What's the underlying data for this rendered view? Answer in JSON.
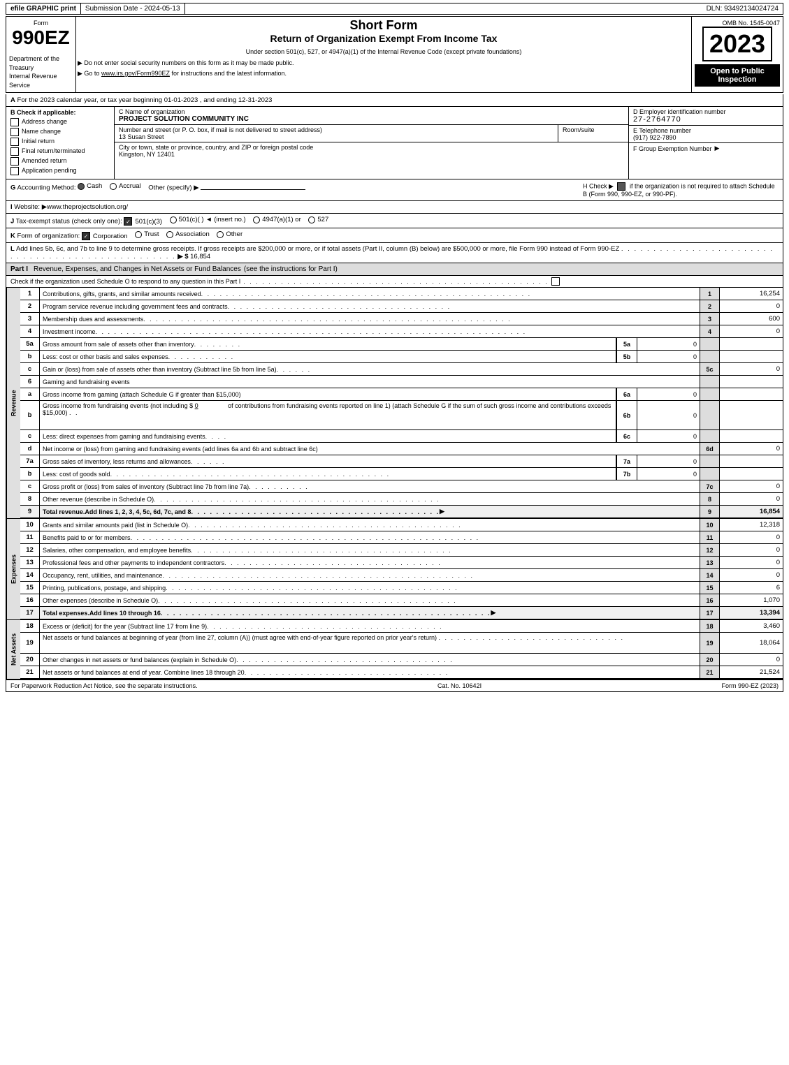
{
  "topBar": {
    "graphic": "efile GRAPHIC print",
    "submission": "Submission Date - 2024-05-13",
    "dln": "DLN: 93492134024724"
  },
  "header": {
    "ombNo": "OMB No. 1545-0047",
    "formNumber": "990EZ",
    "shortForm": "Short Form",
    "returnTitle": "Return of Organization Exempt From Income Tax",
    "underSection": "Under section 501(c), 527, or 4947(a)(1) of the Internal Revenue Code (except private foundations)",
    "socialSecNote": "▶ Do not enter social security numbers on this form as it may be made public.",
    "gotoNote": "▶ Go to www.irs.gov/Form990EZ for instructions and the latest information.",
    "year": "2023",
    "openToPublic": "Open to Public Inspection",
    "deptLine1": "Department of the",
    "deptLine2": "Treasury",
    "deptLine3": "Internal Revenue",
    "deptLine4": "Service"
  },
  "sectionA": {
    "label": "A",
    "text": "For the 2023 calendar year, or tax year beginning 01-01-2023 , and ending 12-31-2023"
  },
  "sectionB": {
    "label": "B Check if applicable:",
    "addressChange": "Address change",
    "nameChange": "Name change",
    "initialReturn": "Initial return",
    "finalReturn": "Final return/terminated",
    "amendedReturn": "Amended return",
    "applicationPending": "Application pending"
  },
  "orgInfo": {
    "cLabel": "C Name of organization",
    "orgName": "PROJECT SOLUTION COMMUNITY INC",
    "streetLabel": "Number and street (or P. O. box, if mail is not delivered to street address)",
    "streetValue": "13 Susan Street",
    "roomLabel": "Room/suite",
    "roomValue": "",
    "cityLabel": "City or town, state or province, country, and ZIP or foreign postal code",
    "cityValue": "Kingston, NY  12401",
    "dLabel": "D Employer identification number",
    "ein": "27-2764770",
    "eLabel": "E Telephone number",
    "phone": "(917) 922-7890",
    "fLabel": "F Group Exemption Number",
    "fValue": ""
  },
  "sectionG": {
    "label": "G",
    "text": "Accounting Method:",
    "cash": "Cash",
    "cashChecked": true,
    "accrual": "Accrual",
    "accrualChecked": false,
    "other": "Other (specify) ▶",
    "otherValue": "",
    "hLabel": "H Check ▶",
    "hText": "if the organization is not required to attach Schedule B (Form 990, 990-EZ, or 990-PF).",
    "hChecked": true
  },
  "sectionI": {
    "label": "I",
    "text": "Website: ▶www.theprojectsolution.org/"
  },
  "sectionJ": {
    "label": "J",
    "text": "Tax-exempt status (check only one):",
    "options": [
      "501(c)(3)",
      "501(c)(  ) ◄ (insert no.)",
      "4947(a)(1) or",
      "527"
    ],
    "selected": "501(c)(3)"
  },
  "sectionK": {
    "label": "K",
    "text": "Form of organization:",
    "options": [
      "Corporation",
      "Trust",
      "Association",
      "Other"
    ],
    "selected": "Corporation"
  },
  "sectionL": {
    "text": "L Add lines 5b, 6c, and 7b to line 9 to determine gross receipts. If gross receipts are $200,000 or more, or if total assets (Part II, column (B) below) are $500,000 or more, file Form 990 instead of Form 990-EZ",
    "dots": ". . . . . . . . . . . . . . . . . . . . . . . . . . . . . . . . . . . . . . . . . . . . . . . . . .",
    "arrow": "▶ $",
    "value": "16,854"
  },
  "partI": {
    "title": "Part I",
    "description": "Revenue, Expenses, and Changes in Net Assets or Fund Balances",
    "seeInstructions": "(see the instructions for Part I)",
    "checkNote": "Check if the organization used Schedule O to respond to any question in this Part I",
    "rows": [
      {
        "num": "1",
        "desc": "Contributions, gifts, grants, and similar amounts received",
        "dots": true,
        "lineNum": "1",
        "value": "16,254"
      },
      {
        "num": "2",
        "desc": "Program service revenue including government fees and contracts",
        "dots": true,
        "lineNum": "2",
        "value": "0"
      },
      {
        "num": "3",
        "desc": "Membership dues and assessments",
        "dots": true,
        "lineNum": "3",
        "value": "600"
      },
      {
        "num": "4",
        "desc": "Investment income",
        "dots": true,
        "lineNum": "4",
        "value": "0"
      },
      {
        "num": "5a",
        "subLabel": "a",
        "desc": "Gross amount from sale of assets other than inventory",
        "dots": true,
        "inlineLabel": "5a",
        "inlineValue": "0"
      },
      {
        "num": "5b",
        "subLabel": "b",
        "desc": "Less: cost or other basis and sales expenses",
        "dots": true,
        "inlineLabel": "5b",
        "inlineValue": "0"
      },
      {
        "num": "5c",
        "subLabel": "c",
        "desc": "Gain or (loss) from sale of assets other than inventory (Subtract line 5b from line 5a)",
        "dots": true,
        "lineNum": "5c",
        "value": "0"
      },
      {
        "num": "6",
        "desc": "Gaming and fundraising events"
      },
      {
        "num": "6a",
        "subLabel": "a",
        "desc": "Gross income from gaming (attach Schedule G if greater than $15,000)",
        "inlineLabel": "6a",
        "inlineValue": "0"
      },
      {
        "num": "6b",
        "subLabel": "b",
        "desc": "Gross income from fundraising events (not including $ 0 of contributions from fundraising events reported on line 1) (attach Schedule G if the sum of such gross income and contributions exceeds $15,000)",
        "dots": true,
        "inlineLabel": "6b",
        "inlineValue": "0"
      },
      {
        "num": "6c",
        "subLabel": "c",
        "desc": "Less: direct expenses from gaming and fundraising events",
        "dots": true,
        "inlineLabel": "6c",
        "inlineValue": "0"
      },
      {
        "num": "6d",
        "subLabel": "d",
        "desc": "Net income or (loss) from gaming and fundraising events (add lines 6a and 6b and subtract line 6c)",
        "lineNum": "6d",
        "value": "0"
      },
      {
        "num": "7a",
        "subLabel": "a",
        "desc": "Gross sales of inventory, less returns and allowances",
        "dots": true,
        "inlineLabel": "7a",
        "inlineValue": "0"
      },
      {
        "num": "7b",
        "subLabel": "b",
        "desc": "Less: cost of goods sold",
        "dots": true,
        "inlineLabel": "7b",
        "inlineValue": "0"
      },
      {
        "num": "7c",
        "subLabel": "c",
        "desc": "Gross profit or (loss) from sales of inventory (Subtract line 7b from line 7a)",
        "dots": true,
        "lineNum": "7c",
        "value": "0"
      },
      {
        "num": "8",
        "desc": "Other revenue (describe in Schedule O)",
        "dots": true,
        "lineNum": "8",
        "value": "0"
      },
      {
        "num": "9",
        "desc": "Total revenue. Add lines 1, 2, 3, 4, 5c, 6d, 7c, and 8",
        "dots": true,
        "arrow": true,
        "lineNum": "9",
        "value": "16,854",
        "bold": true
      }
    ]
  },
  "expenses": {
    "rows": [
      {
        "num": "10",
        "desc": "Grants and similar amounts paid (list in Schedule O)",
        "dots": true,
        "lineNum": "10",
        "value": "12,318"
      },
      {
        "num": "11",
        "desc": "Benefits paid to or for members",
        "dots": true,
        "lineNum": "11",
        "value": "0"
      },
      {
        "num": "12",
        "desc": "Salaries, other compensation, and employee benefits",
        "dots": true,
        "lineNum": "12",
        "value": "0"
      },
      {
        "num": "13",
        "desc": "Professional fees and other payments to independent contractors",
        "dots": true,
        "lineNum": "13",
        "value": "0"
      },
      {
        "num": "14",
        "desc": "Occupancy, rent, utilities, and maintenance",
        "dots": true,
        "lineNum": "14",
        "value": "0"
      },
      {
        "num": "15",
        "desc": "Printing, publications, postage, and shipping",
        "dots": true,
        "lineNum": "15",
        "value": "6"
      },
      {
        "num": "16",
        "desc": "Other expenses (describe in Schedule O)",
        "dots": true,
        "lineNum": "16",
        "value": "1,070"
      },
      {
        "num": "17",
        "desc": "Total expenses. Add lines 10 through 16",
        "dots": true,
        "arrow": true,
        "lineNum": "17",
        "value": "13,394",
        "bold": true
      }
    ]
  },
  "netAssets": {
    "rows": [
      {
        "num": "18",
        "desc": "Excess or (deficit) for the year (Subtract line 17 from line 9)",
        "dots": true,
        "lineNum": "18",
        "value": "3,460"
      },
      {
        "num": "19",
        "desc": "Net assets or fund balances at beginning of year (from line 27, column (A)) (must agree with end-of-year figure reported on prior year's return)",
        "dots": true,
        "lineNum": "19",
        "value": "18,064"
      },
      {
        "num": "20",
        "desc": "Other changes in net assets or fund balances (explain in Schedule O)",
        "dots": true,
        "lineNum": "20",
        "value": "0"
      },
      {
        "num": "21",
        "desc": "Net assets or fund balances at end of year. Combine lines 18 through 20",
        "dots": true,
        "lineNum": "21",
        "value": "21,524"
      }
    ]
  },
  "footer": {
    "paperwork": "For Paperwork Reduction Act Notice, see the separate instructions.",
    "catNo": "Cat. No. 10642I",
    "formRef": "Form 990-EZ (2023)"
  },
  "dots": ". . . . . . . . . . . . . . . . . . . . . . . . . . . . . . . . . . . . . . . . . . . . . . . . . . . . . . . . . . . . . . . . . ."
}
